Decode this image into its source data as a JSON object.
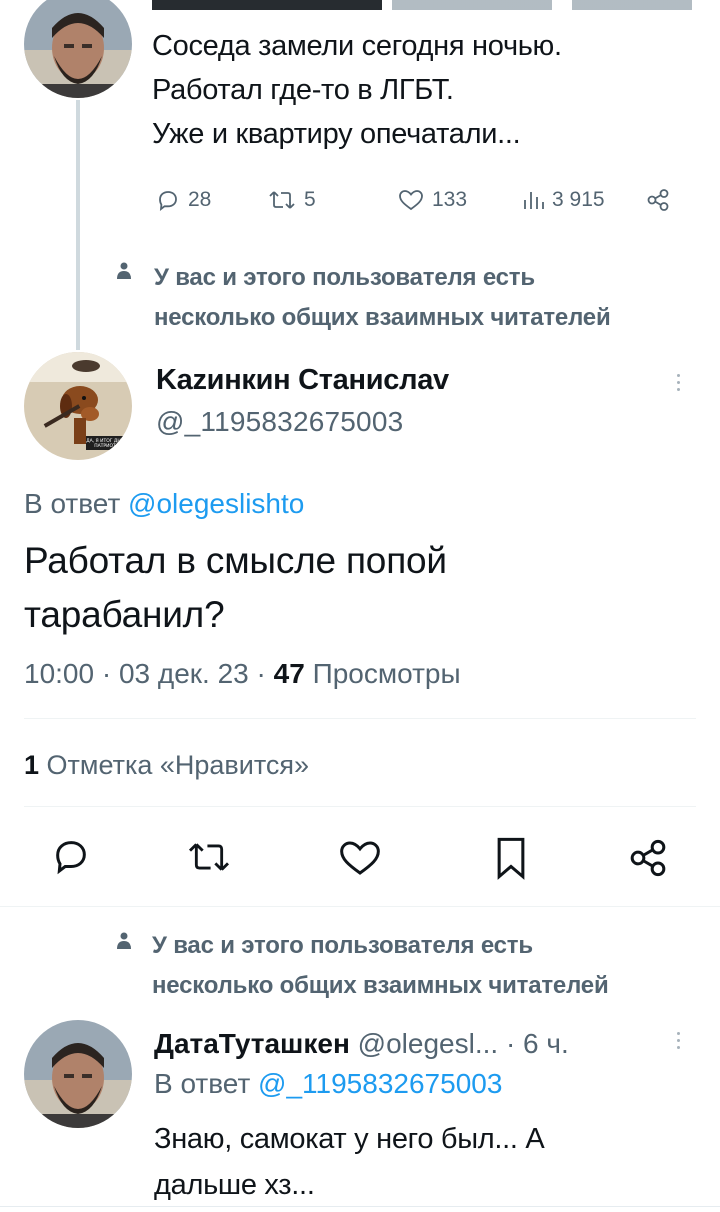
{
  "colors": {
    "accent": "#1d9bf0",
    "muted": "#536471",
    "text": "#0f1419",
    "divider": "#eff3f4"
  },
  "top_tweet": {
    "text_lines": [
      "Соседа замели сегодня ночью.",
      "Работал где-то в ЛГБТ.",
      "Уже и квартиру опечатали..."
    ],
    "stats": {
      "replies": "28",
      "retweets": "5",
      "likes": "133",
      "views": "3 915"
    },
    "icons": [
      "reply-icon",
      "retweet-icon",
      "like-icon",
      "views-icon",
      "share-icon"
    ]
  },
  "mutual_notice_1": {
    "line1": "У вас и этого пользователя есть",
    "line2": "несколько общих взаимных читателей"
  },
  "main_tweet": {
    "author_name": "Kazинкин Станислаv",
    "author_handle": "@_1195832675003",
    "reply_prefix": "В ответ",
    "reply_to": "@olegeslishto",
    "text_line1": "Работал в смысле попой",
    "text_line2": "тарабанил?",
    "time": "10:00",
    "date": "03 дек. 23",
    "views_count": "47",
    "views_label": "Просмотры",
    "likes_count": "1",
    "likes_label": "Отметка «Нравится»",
    "avatar_caption": "ДА, Я ИТОГ ДНЯ ПАТРИОТ"
  },
  "mutual_notice_2": {
    "line1": "У вас и этого пользователя есть",
    "line2": "несколько общих взаимных читателей"
  },
  "reply_tweet": {
    "author_name": "ДатаТуташкен",
    "author_handle": "@olegesl...",
    "time_ago": "· 6 ч.",
    "reply_prefix": "В ответ",
    "reply_to": "@_1195832675003",
    "text_line1": "Знаю, самокат у него был... А",
    "text_line2": "дальше хз..."
  }
}
